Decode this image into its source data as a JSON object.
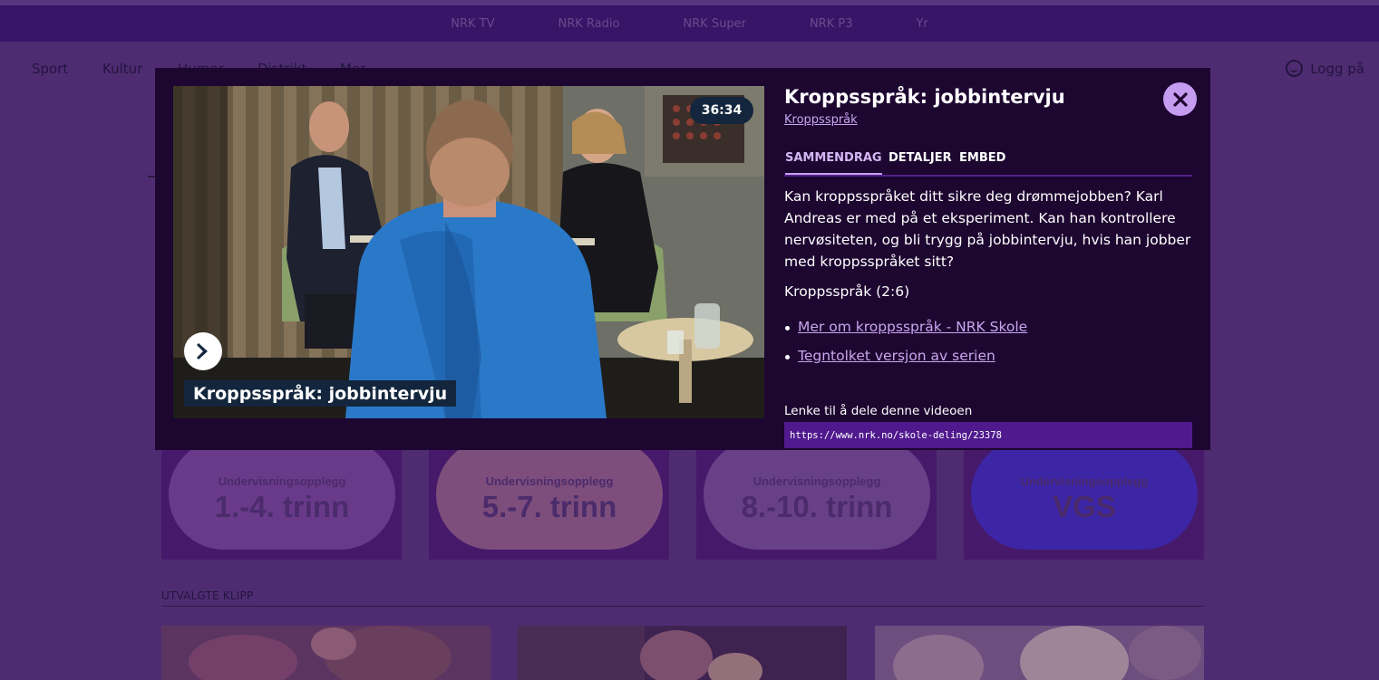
{
  "sites": [
    "NRK TV",
    "NRK Radio",
    "NRK Super",
    "NRK P3",
    "Yr"
  ],
  "nav": [
    "Sport",
    "Kultur",
    "Humor",
    "Distrikt",
    "Mer"
  ],
  "login_label": "Logg på",
  "cards": [
    {
      "sub": "Undervisningsopplegg",
      "big": "1.-4. trinn",
      "color": "#6a3a8a"
    },
    {
      "sub": "Undervisningsopplegg",
      "big": "5.-7. trinn",
      "color": "#7d4e7c"
    },
    {
      "sub": "Undervisningsopplegg",
      "big": "8.-10. trinn",
      "color": "#684088"
    },
    {
      "sub": "Undervisningsopplegg",
      "big": "VGS",
      "color": "#3c26a6"
    }
  ],
  "section_label": "UTVALGTE KLIPP",
  "modal": {
    "title": "Kroppsspråk: jobbintervju",
    "series_link": "Kroppsspråk",
    "duration": "36:34",
    "overlay_title": "Kroppsspråk: jobbintervju",
    "tabs": [
      "SAMMENDRAG",
      "DETALJER",
      "EMBED"
    ],
    "description": "Kan kroppsspråket ditt sikre deg drømmejobben? Karl Andreas er med på et eksperiment. Kan han kontrollere nervøsiteten, og bli trygg på jobbintervju, hvis han jobber med kroppsspråket sitt?",
    "episode": "Kroppsspråk (2:6)",
    "links": [
      "Mer om kroppsspråk - NRK Skole",
      "Tegntolket versjon av serien"
    ],
    "share_label": "Lenke til å dele denne videoen",
    "share_url": "https://www.nrk.no/skole-deling/23378"
  },
  "icons": {
    "play": "chevron-right-icon",
    "close": "close-icon",
    "login": "user-icon"
  },
  "colors": {
    "modal_bg": "#1d0630",
    "accent": "#c59cf0",
    "link": "#c9a6ee",
    "badge_bg": "#13263d"
  }
}
